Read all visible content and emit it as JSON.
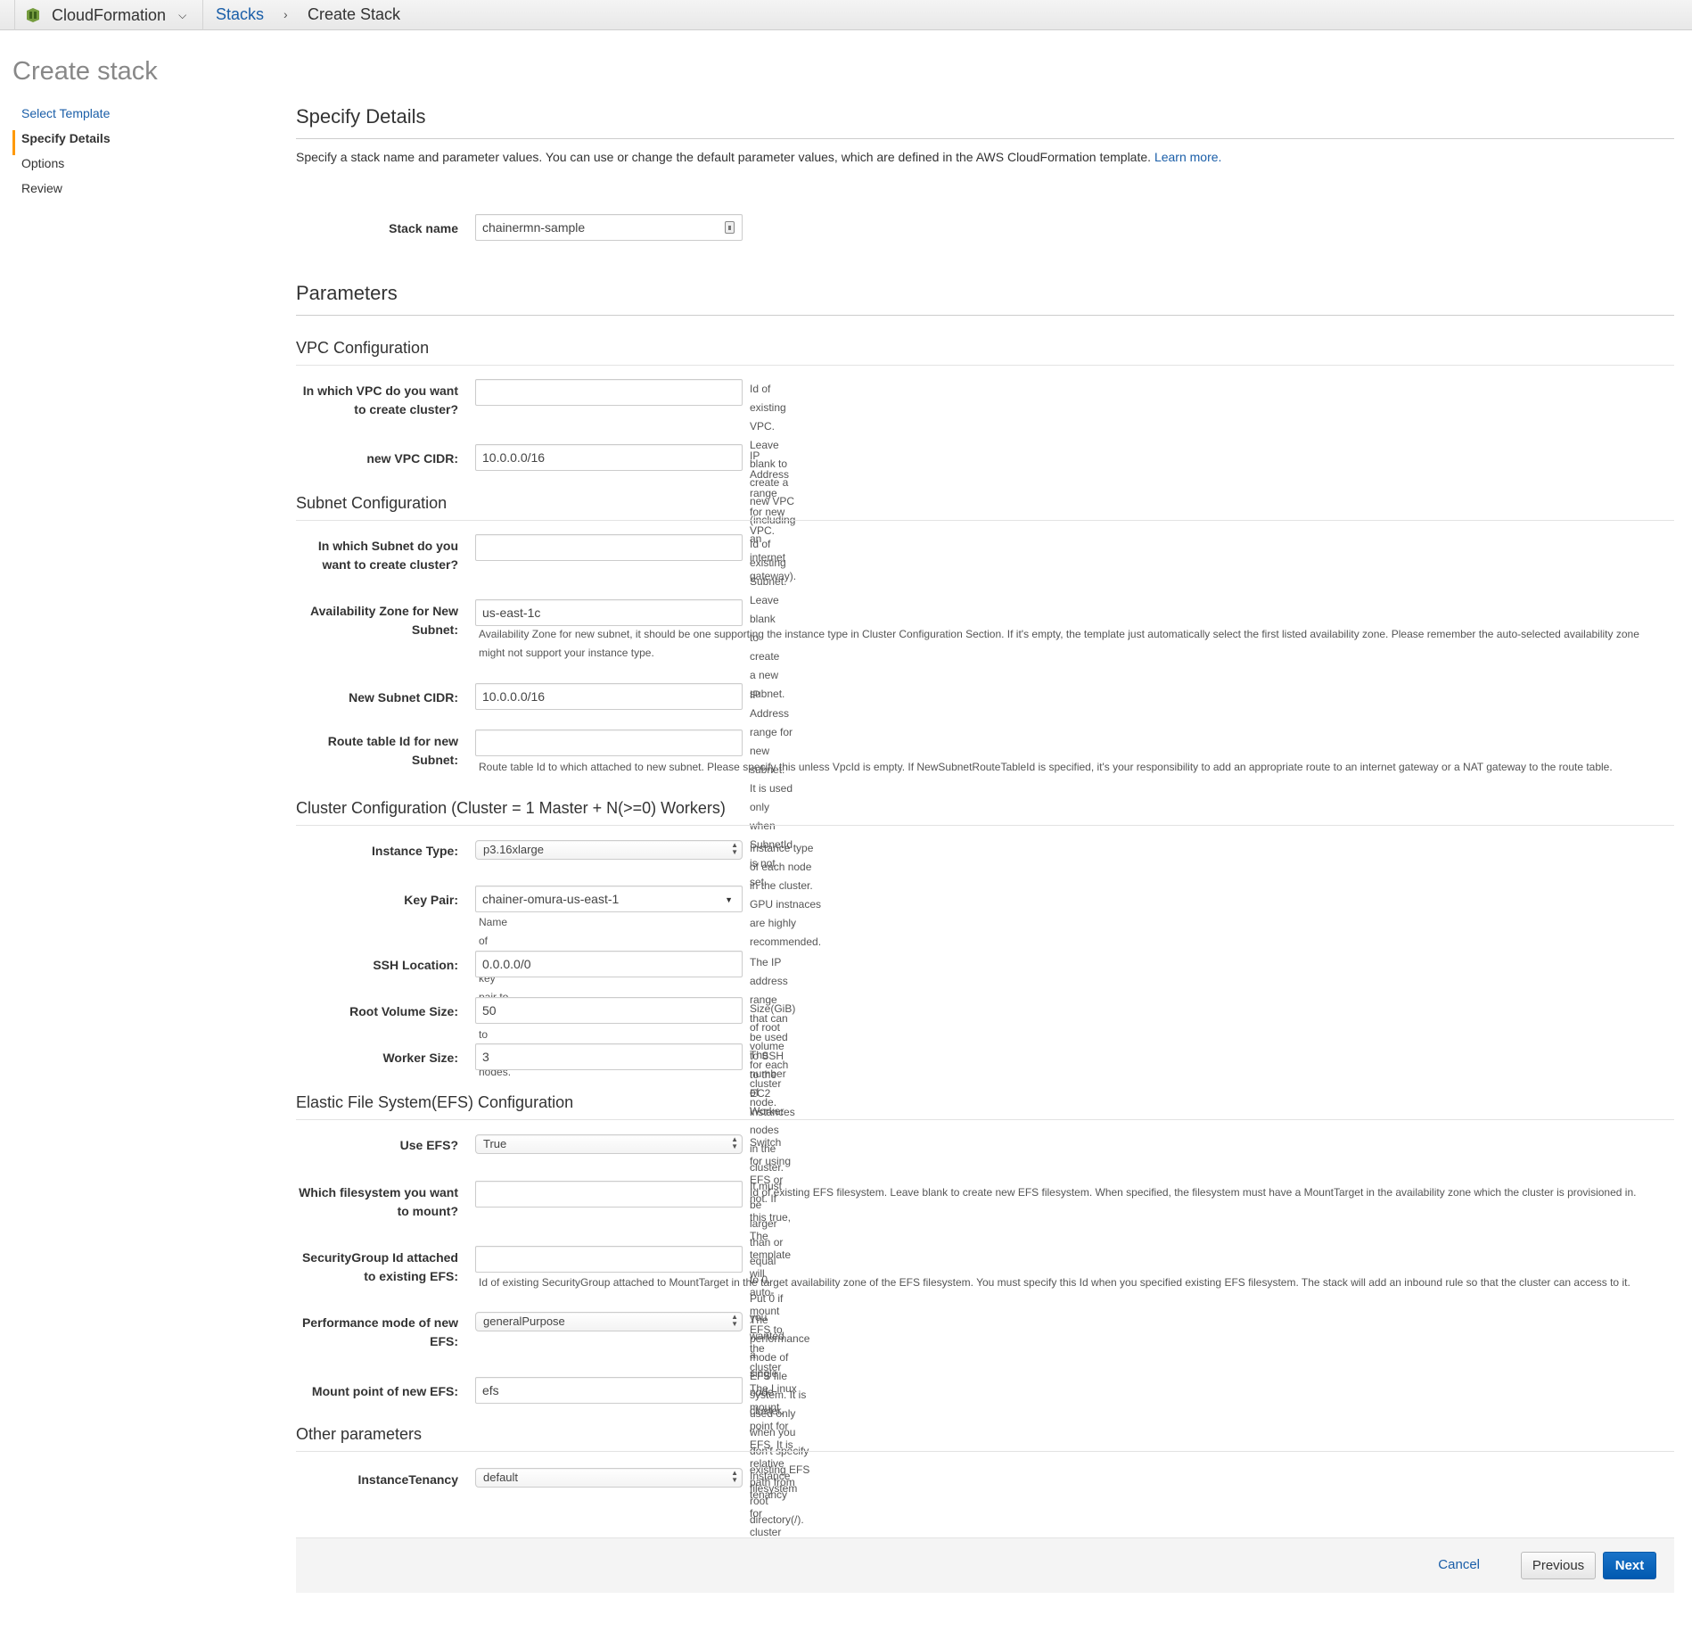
{
  "topbar": {
    "service_name": "CloudFormation",
    "breadcrumb_stacks": "Stacks",
    "breadcrumb_sep": "›",
    "breadcrumb_current": "Create Stack",
    "chevron": "⌄"
  },
  "page_title": "Create stack",
  "steps": [
    {
      "label": "Select Template",
      "state": "link"
    },
    {
      "label": "Specify Details",
      "state": "active"
    },
    {
      "label": "Options",
      "state": "pending"
    },
    {
      "label": "Review",
      "state": "pending"
    }
  ],
  "specify": {
    "heading": "Specify Details",
    "intro": "Specify a stack name and parameter values. You can use or change the default parameter values, which are defined in the AWS CloudFormation template. ",
    "learn_more": "Learn more.",
    "stack_name_label": "Stack name",
    "stack_name_value": "chainermn-sample"
  },
  "parameters_heading": "Parameters",
  "sections": {
    "vpc": "VPC Configuration",
    "subnet": "Subnet Configuration",
    "cluster": "Cluster Configuration (Cluster = 1 Master + N(>=0) Workers)",
    "efs": "Elastic File System(EFS) Configuration",
    "other": "Other parameters"
  },
  "fields": {
    "vpc_id": {
      "label1": "In which VPC do you want",
      "label2": "to create cluster?",
      "value": "",
      "help": "Id of existing VPC. Leave blank to create a new VPC (including an internet gateway)."
    },
    "vpc_cidr": {
      "label": "new VPC CIDR:",
      "value": "10.0.0.0/16",
      "help": "IP Address range for new VPC."
    },
    "subnet_id": {
      "label1": "In which Subnet do you",
      "label2": "want to create cluster?",
      "value": "",
      "help": "Id of existing Subnet. Leave blank to create a new subnet."
    },
    "az": {
      "label1": "Availability Zone for New",
      "label2": "Subnet:",
      "value": "us-east-1c",
      "help1": "Availability Zone for new subnet, it should be one supporting the instance type in Cluster Configuration Section. If it's empty, the template just automatically select the first listed availability zone. Please remember the auto-selected availability zone",
      "help2": "might not support your instance type."
    },
    "subnet_cidr": {
      "label": "New Subnet CIDR:",
      "value": "10.0.0.0/16",
      "help": "IP Address range for new subnet. It is used only when SubnetId is not set."
    },
    "route_table": {
      "label1": "Route table Id for new",
      "label2": "Subnet:",
      "value": "",
      "help": "Route table Id to which attached to new subnet. Please specify this unless VpcId is empty. If NewSubnetRouteTableId is specified, it's your responsibility to add an appropriate route to an internet gateway or a NAT gateway to the route table."
    },
    "instance_type": {
      "label": "Instance Type:",
      "value": "p3.16xlarge",
      "help": "Instance type of each node in the cluster. GPU instnaces are highly recommended."
    },
    "key_pair": {
      "label": "Key Pair:",
      "value": "chainer-omura-us-east-1",
      "help": "Name of SSH key pair to login to cluster nodes."
    },
    "ssh_location": {
      "label": "SSH Location:",
      "value": "0.0.0.0/0",
      "help": "The IP address range that can be used to SSH to the EC2 instances"
    },
    "root_volume": {
      "label": "Root Volume Size:",
      "value": "50",
      "help": "Size(GiB) of root volume for each cluster node."
    },
    "worker_size": {
      "label": "Worker Size:",
      "value": "3",
      "help": "The number of Worker nodes in the cluster. It must be larger than or equal to 0. Put 0 if you wanted a single node cluster."
    },
    "use_efs": {
      "label": "Use EFS?",
      "value": "True",
      "help": "Switch for using EFS or not. If this true, The template will auto-mount EFS to the cluster"
    },
    "efs_id": {
      "label1": "Which filesystem you want",
      "label2": "to mount?",
      "value": "",
      "help": "Id of existing EFS filesystem. Leave blank to create new EFS filesystem. When specified, the filesystem must have a MountTarget in the availability zone which the cluster is provisioned in."
    },
    "efs_sg": {
      "label1": "SecurityGroup Id attached",
      "label2": "to existing EFS:",
      "value": "",
      "help": "Id of existing SecurityGroup attached to MountTarget in the target availability zone of the EFS filesystem. You must specify this Id when you specified existing EFS filesystem. The stack will add an inbound rule so that the cluster can access to it."
    },
    "perf_mode": {
      "label1": "Performance mode of new",
      "label2": "EFS:",
      "value": "generalPurpose",
      "help": "The performance mode of EFS file system. It is used only when you don't specify existing EFS filesystem"
    },
    "mount_point": {
      "label": "Mount point of new EFS:",
      "value": "efs",
      "help": "The Linux mount point for EFS. It is relative path from root directory(/)."
    },
    "tenancy": {
      "label": "InstanceTenancy",
      "value": "default",
      "help": "Instance tenancy for cluster nodes."
    }
  },
  "footer": {
    "cancel": "Cancel",
    "previous": "Previous",
    "next": "Next"
  },
  "colors": {
    "link": "#1a5ea8",
    "active_step_marker": "#ff9900",
    "primary_button": "#0a66c2"
  }
}
